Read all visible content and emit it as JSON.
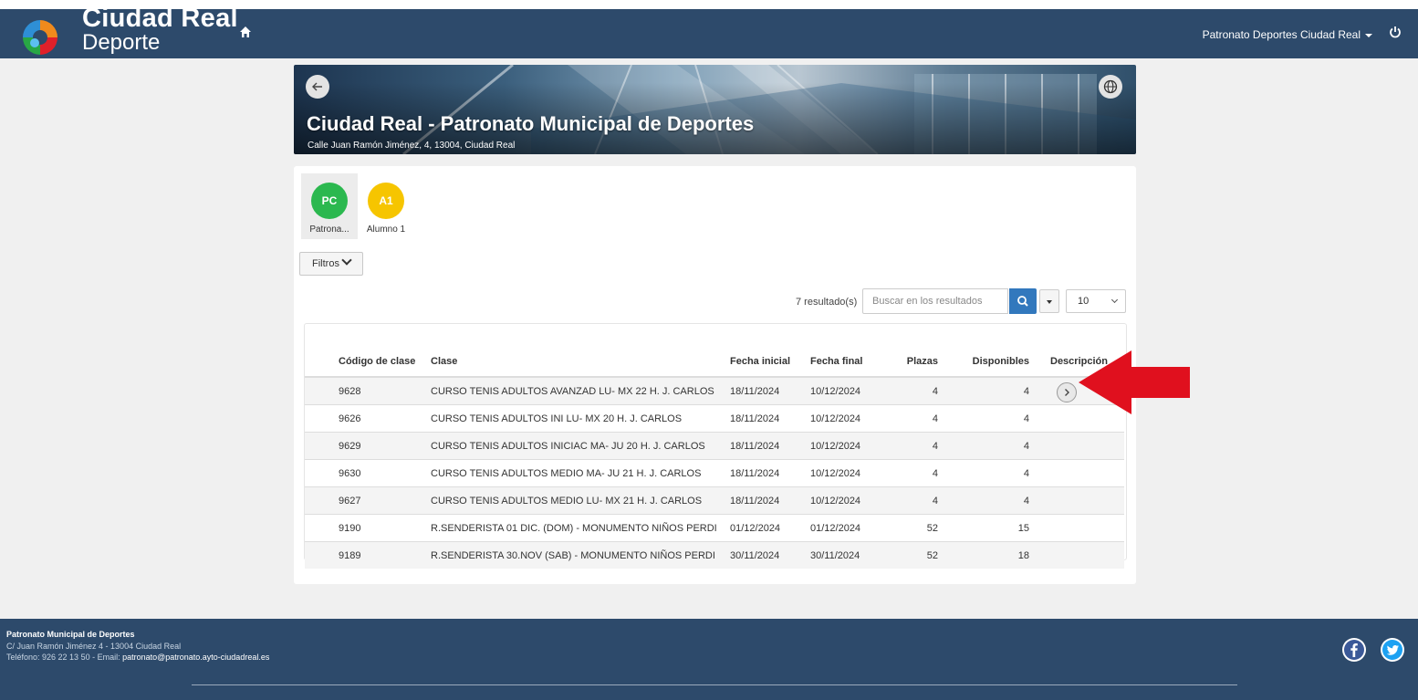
{
  "header": {
    "brand_line1": "Ciudad Real",
    "brand_line2": "Deporte",
    "user_menu": "Patronato Deportes Ciudad Real"
  },
  "banner": {
    "title": "Ciudad Real - Patronato Municipal de Deportes",
    "address": "Calle Juan Ramón Jiménez, 4, 13004, Ciudad Real"
  },
  "persons": [
    {
      "initials": "PC",
      "label": "Patrona...",
      "color": "#2bb84f",
      "active": true
    },
    {
      "initials": "A1",
      "label": "Alumno 1",
      "color": "#f6c500",
      "active": false
    }
  ],
  "filters_label": "Filtros",
  "toolbar": {
    "results": "7 resultado(s)",
    "search_placeholder": "Buscar en los resultados",
    "page_size": "10"
  },
  "table": {
    "headers": {
      "code": "Código de clase",
      "class": "Clase",
      "start": "Fecha inicial",
      "end": "Fecha final",
      "places": "Plazas",
      "available": "Disponibles",
      "description": "Descripción"
    },
    "rows": [
      {
        "code": "9628",
        "class": "CURSO TENIS ADULTOS AVANZAD LU- MX 22 H. J. CARLOS",
        "start": "18/11/2024",
        "end": "10/12/2024",
        "places": "4",
        "available": "4"
      },
      {
        "code": "9626",
        "class": "CURSO TENIS ADULTOS INI LU- MX 20 H. J. CARLOS",
        "start": "18/11/2024",
        "end": "10/12/2024",
        "places": "4",
        "available": "4"
      },
      {
        "code": "9629",
        "class": "CURSO TENIS ADULTOS INICIAC MA- JU 20 H. J. CARLOS",
        "start": "18/11/2024",
        "end": "10/12/2024",
        "places": "4",
        "available": "4"
      },
      {
        "code": "9630",
        "class": "CURSO TENIS ADULTOS MEDIO MA- JU 21 H. J. CARLOS",
        "start": "18/11/2024",
        "end": "10/12/2024",
        "places": "4",
        "available": "4"
      },
      {
        "code": "9627",
        "class": "CURSO TENIS ADULTOS MEDIO LU- MX 21 H. J. CARLOS",
        "start": "18/11/2024",
        "end": "10/12/2024",
        "places": "4",
        "available": "4"
      },
      {
        "code": "9190",
        "class": "R.SENDERISTA 01 DIC. (DOM) - MONUMENTO NIÑOS PERDI",
        "start": "01/12/2024",
        "end": "01/12/2024",
        "places": "52",
        "available": "15"
      },
      {
        "code": "9189",
        "class": "R.SENDERISTA 30.NOV (SAB) - MONUMENTO NIÑOS PERDI",
        "start": "30/11/2024",
        "end": "30/11/2024",
        "places": "52",
        "available": "18"
      }
    ]
  },
  "footer": {
    "title": "Patronato Municipal de Deportes",
    "address": "C/ Juan Ramón Jiménez 4 - 13004 Ciudad Real",
    "phone_prefix": "Teléfono: 926 22 13 50 - Email: ",
    "email": "patronato@patronato.ayto-ciudadreal.es"
  },
  "colors": {
    "navbar": "#2d4a6b",
    "accent_blue": "#3278bd",
    "highlight_arrow": "#e0101e"
  },
  "icons": [
    "home-icon",
    "power-icon",
    "back-arrow-icon",
    "globe-icon",
    "search-icon",
    "chevron-right-icon",
    "facebook-icon",
    "twitter-icon"
  ]
}
